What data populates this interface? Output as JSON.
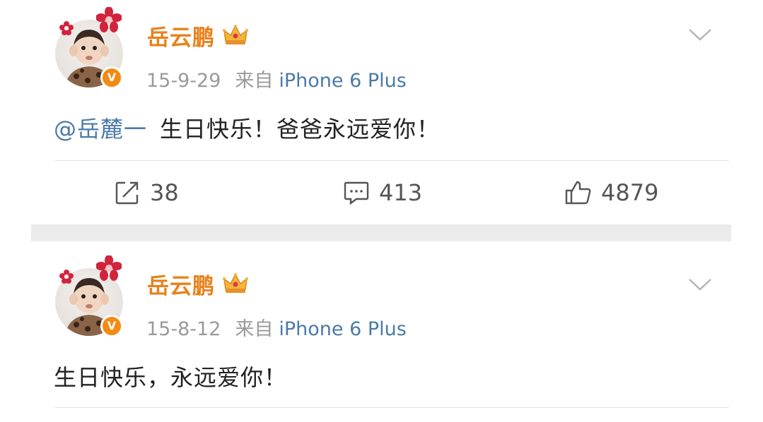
{
  "posts": [
    {
      "author": "岳云鹏",
      "date": "15-9-29",
      "source_prefix": "来自",
      "source_device": "iPhone 6 Plus",
      "mention": "@岳麓一",
      "text": "生日快乐！爸爸永远爱你！",
      "actions": {
        "repost_icon": "share-icon",
        "repost_count": "38",
        "comment_icon": "comment-icon",
        "comment_count": "413",
        "like_icon": "thumbs-up-icon",
        "like_count": "4879"
      }
    },
    {
      "author": "岳云鹏",
      "date": "15-8-12",
      "source_prefix": "来自",
      "source_device": "iPhone 6 Plus",
      "text": "生日快乐，永远爱你！"
    }
  ],
  "colors": {
    "author_name": "#e8811c",
    "link_blue": "#4a7aa8",
    "verify_badge": "#f28a14",
    "meta_gray": "#9a9a9a"
  }
}
